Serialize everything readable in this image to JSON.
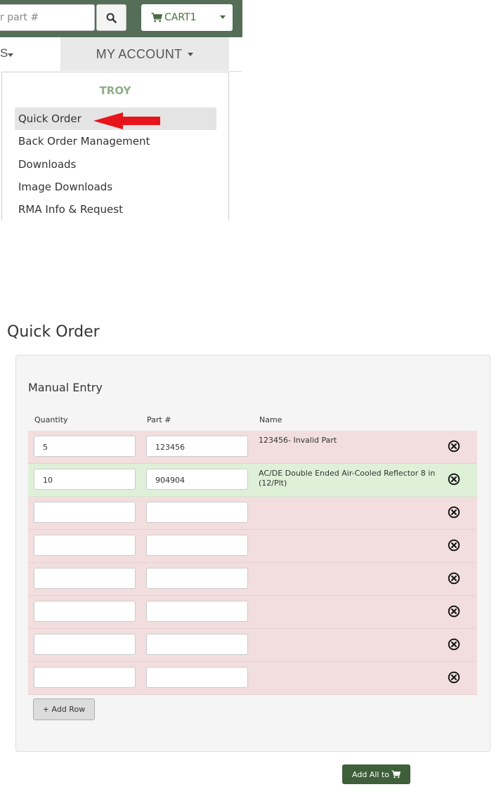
{
  "header": {
    "search_placeholder": "r part #",
    "cart_label": "CART1",
    "nav_left_label": "S",
    "my_account_label": "MY ACCOUNT"
  },
  "dropdown": {
    "header": "TROY",
    "items": [
      {
        "label": "Quick Order",
        "active": true
      },
      {
        "label": "Back Order Management"
      },
      {
        "label": "Downloads"
      },
      {
        "label": "Image Downloads"
      },
      {
        "label": "RMA Info & Request"
      }
    ]
  },
  "quick_order": {
    "title": "Quick Order",
    "section_title": "Manual Entry",
    "columns": {
      "quantity": "Quantity",
      "part": "Part #",
      "name": "Name"
    },
    "rows": [
      {
        "quantity": "5",
        "part": "123456",
        "name": "123456- Invalid Part",
        "status": "invalid"
      },
      {
        "quantity": "10",
        "part": "904904",
        "name": "AC/DE Double Ended Air-Cooled Reflector 8 in (12/Plt)",
        "status": "valid"
      },
      {
        "quantity": "",
        "part": "",
        "name": "",
        "status": "invalid"
      },
      {
        "quantity": "",
        "part": "",
        "name": "",
        "status": "invalid"
      },
      {
        "quantity": "",
        "part": "",
        "name": "",
        "status": "invalid"
      },
      {
        "quantity": "",
        "part": "",
        "name": "",
        "status": "invalid"
      },
      {
        "quantity": "",
        "part": "",
        "name": "",
        "status": "invalid"
      },
      {
        "quantity": "",
        "part": "",
        "name": "",
        "status": "invalid"
      }
    ],
    "add_row_label": "+ Add Row",
    "add_all_label": "Add All to"
  },
  "colors": {
    "header_green": "#546e58",
    "button_green": "#3f5e3a",
    "invalid_row": "#f2dede",
    "valid_row": "#dff0d8",
    "arrow_red": "#e8141b"
  },
  "icons": {
    "search": "search-icon",
    "cart": "cart-icon",
    "remove": "remove-circle-icon"
  }
}
